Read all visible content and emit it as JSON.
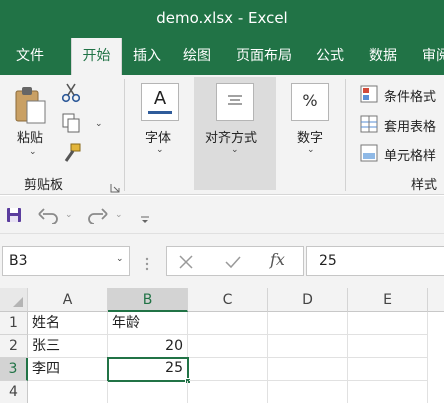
{
  "window": {
    "title": "demo.xlsx  -  Excel"
  },
  "tabs": [
    "文件",
    "开始",
    "插入",
    "绘图",
    "页面布局",
    "公式",
    "数据",
    "审阅"
  ],
  "ribbon": {
    "paste_label": "粘贴",
    "clipboard_group": "剪贴板",
    "font_label": "字体",
    "alignment_label": "对齐方式",
    "number_label": "数字",
    "number_symbol": "%",
    "font_symbol": "A",
    "styles": [
      "条件格式",
      "套用表格",
      "单元格样"
    ],
    "styles_group": "样式"
  },
  "formula_bar": {
    "name_box": "B3",
    "fx_label": "fx",
    "value": "25"
  },
  "sheet": {
    "columns": [
      "A",
      "B",
      "C",
      "D",
      "E"
    ],
    "rows": [
      "1",
      "2",
      "3",
      "4"
    ],
    "cells": [
      [
        "姓名",
        "年龄",
        "",
        "",
        ""
      ],
      [
        "张三",
        "20",
        "",
        "",
        ""
      ],
      [
        "李四",
        "25",
        "",
        "",
        ""
      ],
      [
        "",
        "",
        "",
        "",
        ""
      ]
    ]
  },
  "colors": {
    "accent": "#217346",
    "ribbon_bg": "#f3f3f3"
  }
}
